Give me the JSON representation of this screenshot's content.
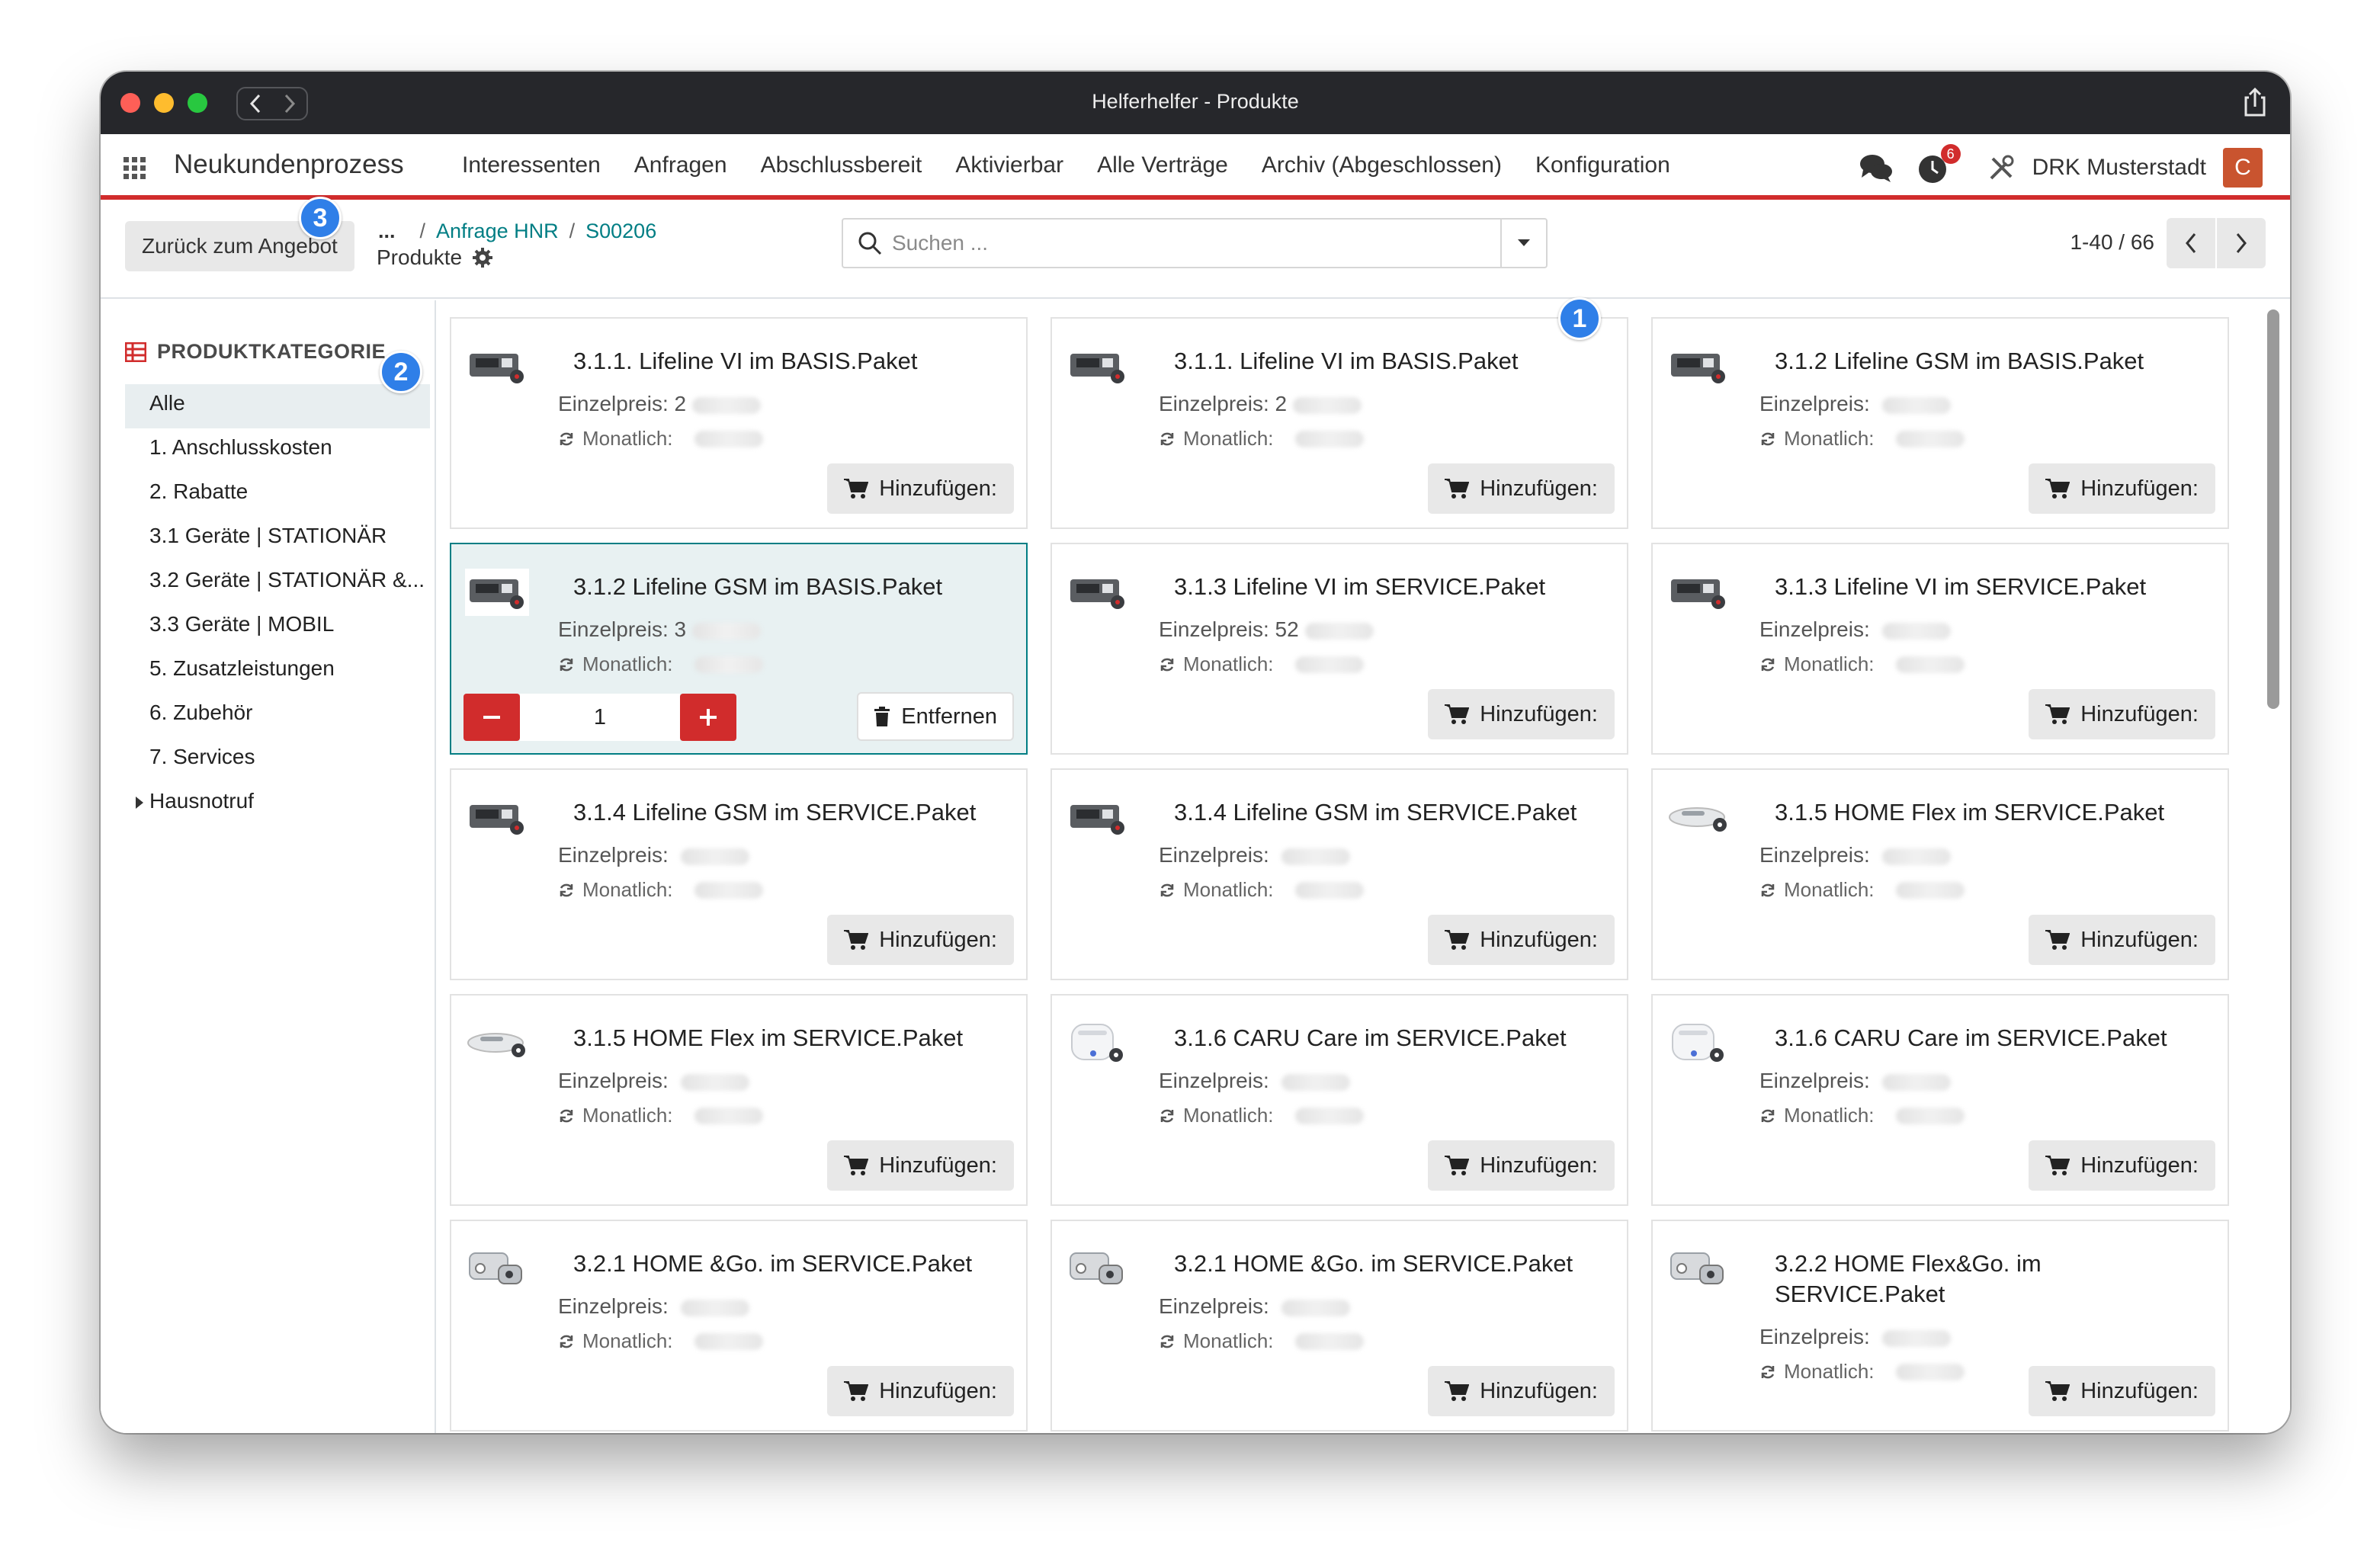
{
  "window": {
    "title": "Helferhelfer - Produkte"
  },
  "nav": {
    "app_name": "Neukundenprozess",
    "menu": [
      "Interessenten",
      "Anfragen",
      "Abschlussbereit",
      "Aktivierbar",
      "Alle Verträge",
      "Archiv (Abgeschlossen)",
      "Konfiguration"
    ],
    "activity_badge": "6",
    "company": "DRK Musterstadt",
    "avatar_letter": "C"
  },
  "control": {
    "back_label": "Zurück zum Angebot",
    "breadcrumb_ellipsis": "...",
    "breadcrumbs": [
      "Anfrage HNR",
      "S00206"
    ],
    "breadcrumb_current": "Produkte",
    "search_placeholder": "Suchen ...",
    "pager": "1-40 / 66"
  },
  "sidebar": {
    "heading": "PRODUKTKATEGORIE",
    "items": [
      "Alle",
      "1. Anschlusskosten",
      "2. Rabatte",
      "3.1 Geräte | STATIONÄR",
      "3.2 Geräte | STATIONÄR &...",
      "3.3 Geräte | MOBIL",
      "5. Zusatzleistungen",
      "6. Zubehör",
      "7. Services",
      "Hausnotruf"
    ]
  },
  "labels": {
    "unit_price": "Einzelpreis:",
    "monthly": "Monatlich:",
    "add": "Hinzufügen:",
    "remove": "Entfernen"
  },
  "products": [
    {
      "title": "3.1.1. Lifeline VI im BASIS.Paket",
      "price_visible": "2",
      "monthly_visible": ""
    },
    {
      "title": "3.1.1. Lifeline VI im BASIS.Paket",
      "price_visible": "2",
      "monthly_visible": ""
    },
    {
      "title": "3.1.2 Lifeline GSM im BASIS.Paket",
      "price_visible": "",
      "monthly_visible": ""
    },
    {
      "title": "3.1.2 Lifeline GSM im BASIS.Paket",
      "price_visible": "3",
      "monthly_visible": "",
      "quantity": "1"
    },
    {
      "title": "3.1.3 Lifeline VI im SERVICE.Paket",
      "price_visible": "52",
      "monthly_visible": ""
    },
    {
      "title": "3.1.3 Lifeline VI im SERVICE.Paket",
      "price_visible": "",
      "monthly_visible": ""
    },
    {
      "title": "3.1.4 Lifeline GSM im SERVICE.Paket",
      "price_visible": "",
      "monthly_visible": ""
    },
    {
      "title": "3.1.4 Lifeline GSM im SERVICE.Paket",
      "price_visible": "",
      "monthly_visible": ""
    },
    {
      "title": "3.1.5 HOME Flex im SERVICE.Paket",
      "price_visible": "",
      "monthly_visible": ""
    },
    {
      "title": "3.1.5 HOME Flex im SERVICE.Paket",
      "price_visible": "",
      "monthly_visible": ""
    },
    {
      "title": "3.1.6 CARU Care im SERVICE.Paket",
      "price_visible": "",
      "monthly_visible": ""
    },
    {
      "title": "3.1.6 CARU Care im SERVICE.Paket",
      "price_visible": "",
      "monthly_visible": ""
    },
    {
      "title": "3.2.1 HOME &Go. im SERVICE.Paket",
      "price_visible": "",
      "monthly_visible": ""
    },
    {
      "title": "3.2.1 HOME &Go. im SERVICE.Paket",
      "price_visible": "",
      "monthly_visible": ""
    },
    {
      "title": "3.2.2 HOME Flex&Go. im SERVICE.Paket",
      "price_visible": "",
      "monthly_visible": ""
    }
  ],
  "markers": [
    "1",
    "2",
    "3"
  ],
  "colors": {
    "brand_red": "#d12c2c",
    "teal_link": "#017e84",
    "marker_blue": "#2f7fe8"
  }
}
